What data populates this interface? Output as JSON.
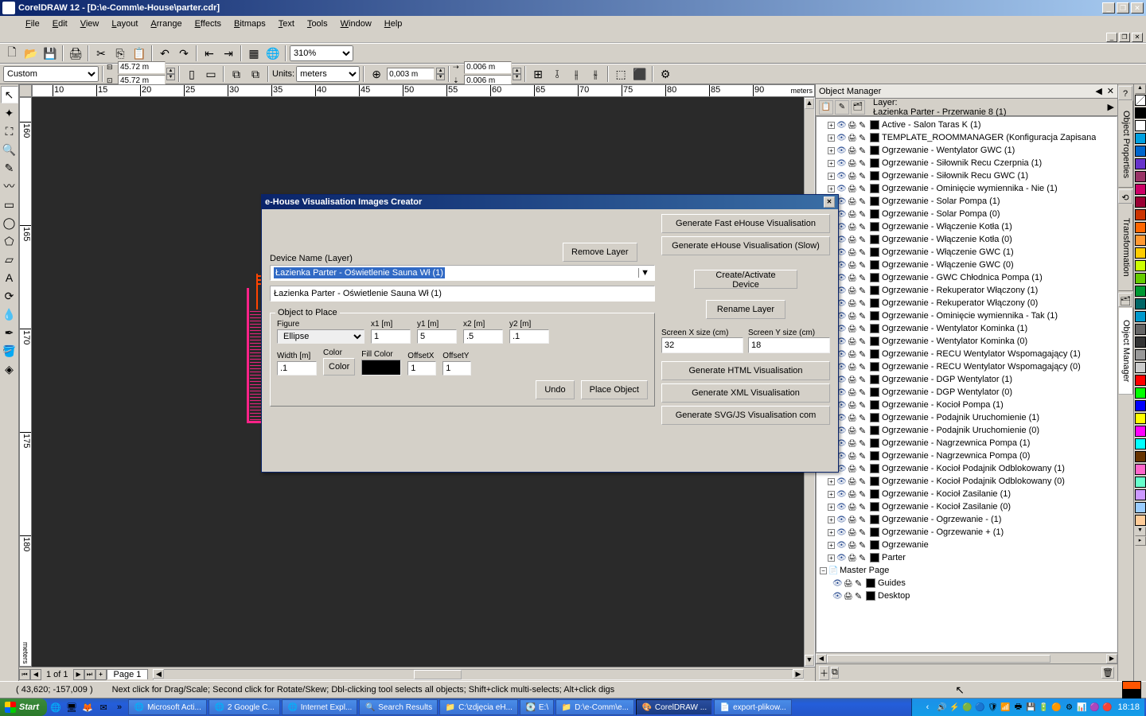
{
  "title": "CorelDRAW 12 - [D:\\e-Comm\\e-House\\parter.cdr]",
  "menu": [
    "File",
    "Edit",
    "View",
    "Layout",
    "Arrange",
    "Effects",
    "Bitmaps",
    "Text",
    "Tools",
    "Window",
    "Help"
  ],
  "toolbar": {
    "zoom": "310%"
  },
  "propbar": {
    "paper": "Custom",
    "w": "45.72 m",
    "h": "45.72 m",
    "units_label": "Units:",
    "units_value": "meters",
    "nudge": "0,003 m",
    "dup_x": "0.006 m",
    "dup_y": "0.006 m"
  },
  "rulers": {
    "h_unit": "meters",
    "v_unit": "meters",
    "h_ticks": [
      "10",
      "15",
      "20",
      "25",
      "30",
      "35",
      "40",
      "45",
      "50",
      "55",
      "60",
      "65",
      "70",
      "75",
      "80",
      "85",
      "90"
    ],
    "v_ticks": [
      "160",
      "165",
      "170",
      "175",
      "180"
    ]
  },
  "page_tabs": {
    "count": "1 of 1",
    "tab": "Page 1"
  },
  "status": {
    "coords": "( 43,620; -157,009 )",
    "hint": "Next click for Drag/Scale; Second click for Rotate/Skew; Dbl-clicking tool selects all objects; Shift+click multi-selects; Alt+click digs",
    "fill_color": "#ff5500",
    "outline_color": "#000000"
  },
  "docker": {
    "title": "Object Manager",
    "layer_label": "Layer:",
    "layer_value": "Łazienka Parter - Przerwanie 8 (1)",
    "items": [
      "Active - Salon Taras K (1)",
      "TEMPLATE_ROOMMANAGER (Konfiguracja Zapisana",
      "Ogrzewanie - Wentylator GWC (1)",
      "Ogrzewanie - Siłownik Recu Czerpnia (1)",
      "Ogrzewanie - Siłownik Recu GWC (1)",
      "Ogrzewanie - Ominięcie wymiennika - Nie (1)",
      "Ogrzewanie - Solar Pompa (1)",
      "Ogrzewanie - Solar Pompa (0)",
      "Ogrzewanie - Włączenie Kotła (1)",
      "Ogrzewanie - Włączenie Kotła (0)",
      "Ogrzewanie - Włączenie GWC (1)",
      "Ogrzewanie - Włączenie GWC (0)",
      "Ogrzewanie - GWC Chłodnica Pompa (1)",
      "Ogrzewanie - Rekuperator Włączony (1)",
      "Ogrzewanie - Rekuperator Włączony (0)",
      "Ogrzewanie - Ominięcie wymiennika - Tak (1)",
      "Ogrzewanie - Wentylator Kominka (1)",
      "Ogrzewanie - Wentylator Kominka (0)",
      "Ogrzewanie - RECU Wentylator Wspomagający (1)",
      "Ogrzewanie - RECU Wentylator Wspomagający (0)",
      "Ogrzewanie - DGP Wentylator (1)",
      "Ogrzewanie - DGP Wentylator (0)",
      "Ogrzewanie - Kocioł Pompa (1)",
      "Ogrzewanie - Podajnik Uruchomienie (1)",
      "Ogrzewanie - Podajnik Uruchomienie (0)",
      "Ogrzewanie - Nagrzewnica Pompa (1)",
      "Ogrzewanie - Nagrzewnica Pompa (0)",
      "Ogrzewanie - Kocioł Podajnik Odblokowany (1)",
      "Ogrzewanie - Kocioł Podajnik Odblokowany (0)",
      "Ogrzewanie - Kocioł Zasilanie (1)",
      "Ogrzewanie - Kocioł Zasilanie (0)",
      "Ogrzewanie - Ogrzewanie - (1)",
      "Ogrzewanie - Ogrzewanie + (1)",
      "Ogrzewanie",
      "Parter"
    ],
    "master_page": "Master Page",
    "guides": "Guides",
    "desktop": "Desktop"
  },
  "side_tabs": [
    "Object Properties",
    "Transformation",
    "Object Manager"
  ],
  "palette": [
    "#ffffff00",
    "#000000",
    "#ffffff",
    "#00a0e0",
    "#0066cc",
    "#6633cc",
    "#993366",
    "#cc0066",
    "#990033",
    "#cc3300",
    "#ff6600",
    "#ff9933",
    "#ffcc00",
    "#ccff00",
    "#66cc00",
    "#009933",
    "#006666",
    "#0099cc",
    "#666666",
    "#333333",
    "#999999",
    "#cccccc",
    "#ff0000",
    "#00ff00",
    "#0000ff",
    "#ffff00",
    "#ff00ff",
    "#00ffff",
    "#663300",
    "#ff66cc",
    "#66ffcc",
    "#cc99ff",
    "#99ccff",
    "#ffcc99"
  ],
  "dialog": {
    "title": "e-House Visualisation Images Creator",
    "remove_layer": "Remove Layer",
    "device_name_label": "Device Name (Layer)",
    "combo_value": "Łazienka Parter - Oświetlenie Sauna Wł (1)",
    "text_value": "Łazienka Parter - Oświetlenie Sauna Wł (1)",
    "object_to_place": "Object to Place",
    "figure_label": "Figure",
    "figure_value": "Ellipse",
    "x1_label": "x1 [m]",
    "x1": "1",
    "y1_label": "y1 [m]",
    "y1": "5",
    "x2_label": "x2 [m]",
    "x2": ".5",
    "y2_label": "y2 [m]",
    "y2": ".1",
    "width_label": "Width [m]",
    "width": ".1",
    "color_label": "Color",
    "color_btn": "Color",
    "fillcolor_label": "Fill Color",
    "offsetx_label": "OffsetX",
    "offsetx": "1",
    "offsety_label": "OffsetY",
    "offsety": "1",
    "undo": "Undo",
    "place": "Place Object",
    "gen_fast": "Generate Fast eHouse Visualisation",
    "gen_slow": "Generate eHouse Visualisation (Slow)",
    "create_activate": "Create/Activate Device",
    "rename_layer": "Rename Layer",
    "sx_label": "Screen X size (cm)",
    "sx": "32",
    "sy_label": "Screen Y size (cm)",
    "sy": "18",
    "gen_html": "Generate HTML Visualisation",
    "gen_xml": "Generate XML Visualisation",
    "gen_svg": "Generate SVG/JS Visualisation com"
  },
  "taskbar": {
    "start": "Start",
    "items": [
      "Microsoft Acti...",
      "2 Google C...",
      "Internet Expl...",
      "Search Results",
      "C:\\zdjęcia eH...",
      "E:\\",
      "D:\\e-Comm\\e...",
      "CorelDRAW ...",
      "export-plikow..."
    ],
    "active_index": 7,
    "time": "18:18"
  }
}
